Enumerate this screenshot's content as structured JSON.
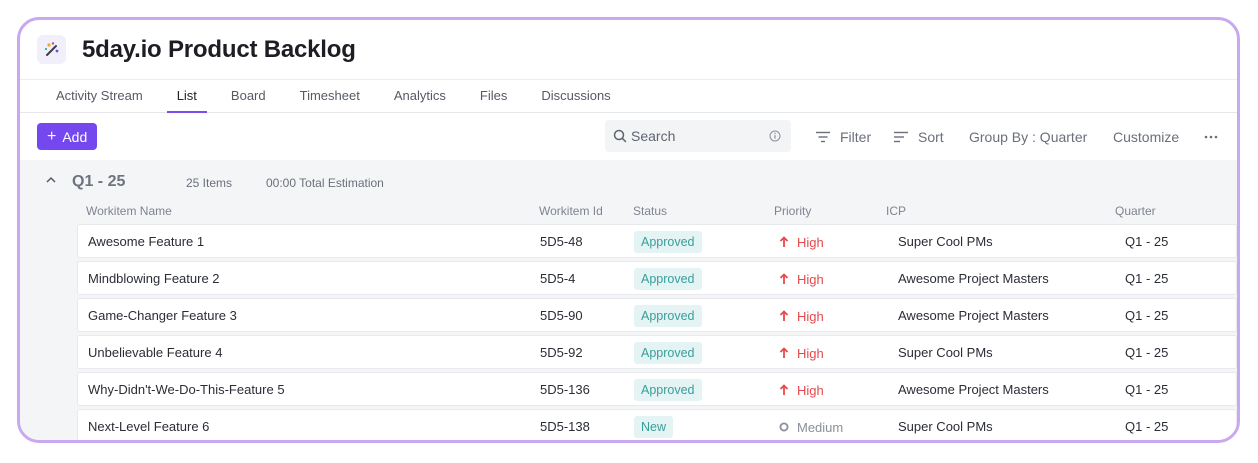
{
  "app": {
    "title": "5day.io Product Backlog",
    "logo_icon": "magic-wand-icon",
    "accent": "#7547ef"
  },
  "tabs": [
    {
      "label": "Activity Stream",
      "active": false
    },
    {
      "label": "List",
      "active": true
    },
    {
      "label": "Board",
      "active": false
    },
    {
      "label": "Timesheet",
      "active": false
    },
    {
      "label": "Analytics",
      "active": false
    },
    {
      "label": "Files",
      "active": false
    },
    {
      "label": "Discussions",
      "active": false
    }
  ],
  "toolbar": {
    "add_label": "Add",
    "search_placeholder": "Search",
    "filter_label": "Filter",
    "sort_label": "Sort",
    "group_by_label": "Group By : Quarter",
    "customize_label": "Customize",
    "more_icon": "more-horizontal-icon"
  },
  "group": {
    "title": "Q1 - 25",
    "count": "25 Items",
    "estimation": "00:00 Total Estimation"
  },
  "columns": {
    "name": "Workitem Name",
    "id": "Workitem Id",
    "status": "Status",
    "priority": "Priority",
    "icp": "ICP",
    "quarter": "Quarter"
  },
  "rows": [
    {
      "name": "Awesome Feature 1",
      "id": "5D5-48",
      "status": "Approved",
      "priority": "High",
      "icp": "Super Cool PMs",
      "quarter": "Q1 - 25"
    },
    {
      "name": "Mindblowing Feature 2",
      "id": "5D5-4",
      "status": "Approved",
      "priority": "High",
      "icp": "Awesome Project Masters",
      "quarter": "Q1 - 25"
    },
    {
      "name": "Game-Changer Feature 3",
      "id": "5D5-90",
      "status": "Approved",
      "priority": "High",
      "icp": "Awesome Project Masters",
      "quarter": "Q1 - 25"
    },
    {
      "name": "Unbelievable Feature 4",
      "id": "5D5-92",
      "status": "Approved",
      "priority": "High",
      "icp": "Super Cool PMs",
      "quarter": "Q1 - 25"
    },
    {
      "name": "Why-Didn't-We-Do-This-Feature 5",
      "id": "5D5-136",
      "status": "Approved",
      "priority": "High",
      "icp": "Awesome Project Masters",
      "quarter": "Q1 - 25"
    },
    {
      "name": "Next-Level Feature 6",
      "id": "5D5-138",
      "status": "New",
      "priority": "Medium",
      "icp": "Super Cool PMs",
      "quarter": "Q1 - 25"
    }
  ]
}
